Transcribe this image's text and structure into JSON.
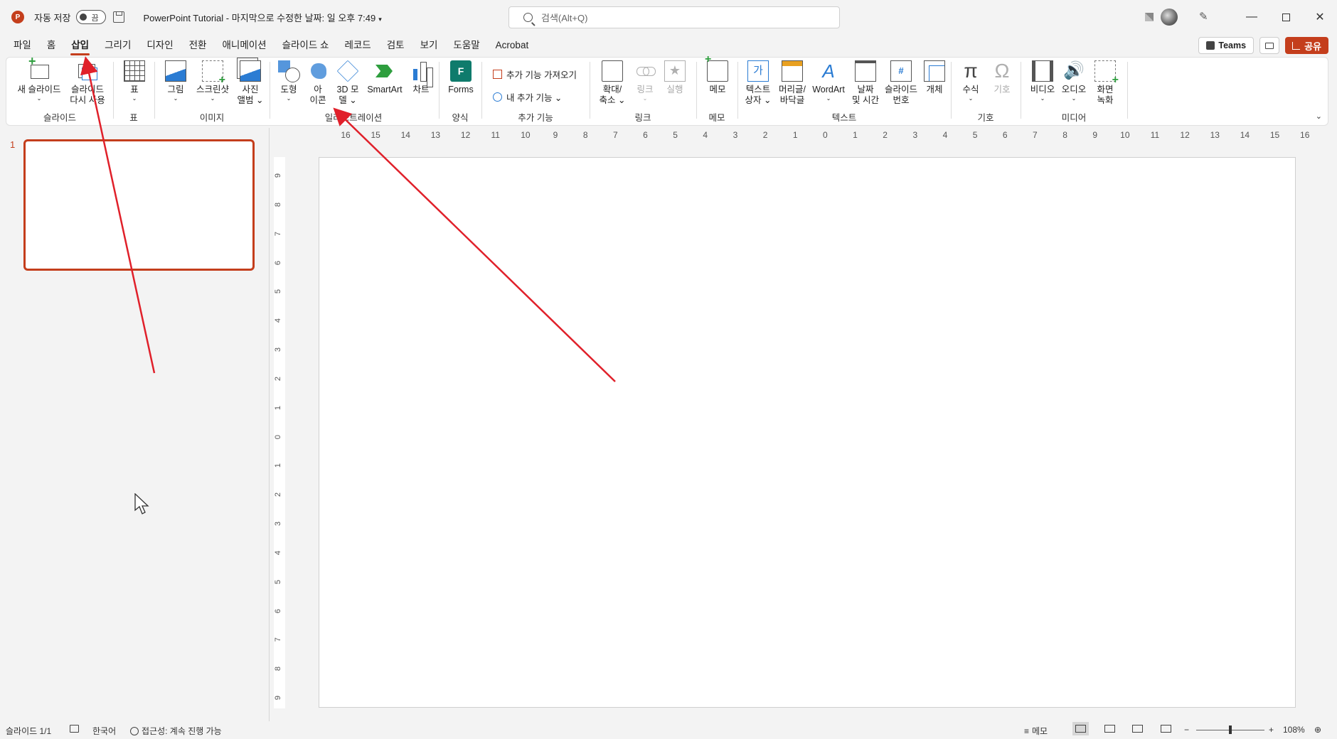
{
  "titlebar": {
    "app_logo": "P",
    "autosave_label": "자동 저장",
    "autosave_state": "끔",
    "doc_title": "PowerPoint Tutorial  -  마지막으로 수정한 날짜: 일 오후 7:49",
    "search_placeholder": "검색(Alt+Q)",
    "minimize": "—",
    "close": "✕"
  },
  "menu": {
    "tabs": [
      "파일",
      "홈",
      "삽입",
      "그리기",
      "디자인",
      "전환",
      "애니메이션",
      "슬라이드 쇼",
      "레코드",
      "검토",
      "보기",
      "도움말",
      "Acrobat"
    ],
    "active_tab": "삽입",
    "teams_label": "Teams",
    "share_label": "공유"
  },
  "ribbon": {
    "groups": {
      "slides": "슬라이드",
      "table": "표",
      "images": "이미지",
      "illustrations": "일러스트레이션",
      "forms": "양식",
      "addins": "추가 기능",
      "links": "링크",
      "comments": "메모",
      "text": "텍스트",
      "symbols": "기호",
      "media": "미디어"
    },
    "buttons": {
      "new_slide": [
        "새 슬라이드",
        "⌄"
      ],
      "reuse_slides": [
        "슬라이드",
        "다시 사용"
      ],
      "table": [
        "표",
        "⌄"
      ],
      "pictures": [
        "그림",
        "⌄"
      ],
      "screenshot": [
        "스크린샷",
        "⌄"
      ],
      "photo_album": [
        "사진",
        "앨범 ⌄"
      ],
      "shapes": [
        "도형",
        "⌄"
      ],
      "icons": [
        "아",
        "이콘"
      ],
      "models3d": [
        "3D 모",
        "델 ⌄"
      ],
      "smartart": [
        "SmartArt"
      ],
      "chart": [
        "차트"
      ],
      "forms": [
        "Forms"
      ],
      "get_addins": "추가 기능 가져오기",
      "my_addins": "내 추가 기능   ⌄",
      "zoom": [
        "확대/",
        "축소 ⌄"
      ],
      "link": [
        "링크",
        "⌄"
      ],
      "action": [
        "실행"
      ],
      "comment": [
        "메모"
      ],
      "textbox": [
        "텍스트",
        "상자 ⌄"
      ],
      "header_footer": [
        "머리글/",
        "바닥글"
      ],
      "wordart": [
        "WordArt",
        "⌄"
      ],
      "date_time": [
        "날짜",
        "및 시간"
      ],
      "slide_number": [
        "슬라이드",
        "번호"
      ],
      "object": [
        "개체"
      ],
      "equation": [
        "수식",
        "⌄"
      ],
      "symbol": [
        "기호"
      ],
      "video": [
        "비디오",
        "⌄"
      ],
      "audio": [
        "오디오",
        "⌄"
      ],
      "screen_recording": [
        "화면",
        "녹화"
      ]
    },
    "icon_text": {
      "forms": "F",
      "textbox": "가",
      "wordart": "A",
      "slide_number": "#",
      "equation": "π",
      "symbol": "Ω",
      "audio": "🔊",
      "action": "★"
    }
  },
  "ruler": {
    "horizontal": [
      "16",
      "15",
      "14",
      "13",
      "12",
      "11",
      "10",
      "9",
      "8",
      "7",
      "6",
      "5",
      "4",
      "3",
      "2",
      "1",
      "0",
      "1",
      "2",
      "3",
      "4",
      "5",
      "6",
      "7",
      "8",
      "9",
      "10",
      "11",
      "12",
      "13",
      "14",
      "15",
      "16"
    ],
    "vertical": [
      "9",
      "8",
      "7",
      "6",
      "5",
      "4",
      "3",
      "2",
      "1",
      "0",
      "1",
      "2",
      "3",
      "4",
      "5",
      "6",
      "7",
      "8",
      "9"
    ]
  },
  "slides_pane": {
    "slide_number": "1"
  },
  "status": {
    "slide_info": "슬라이드 1/1",
    "language": "한국어",
    "accessibility": "접근성: 계속 진행 가능",
    "notes": "메모",
    "zoom_minus": "−",
    "zoom_plus": "+",
    "zoom_level": "108%"
  },
  "colors": {
    "accent": "#c43e1c",
    "annotation_arrow": "#e0202a"
  }
}
